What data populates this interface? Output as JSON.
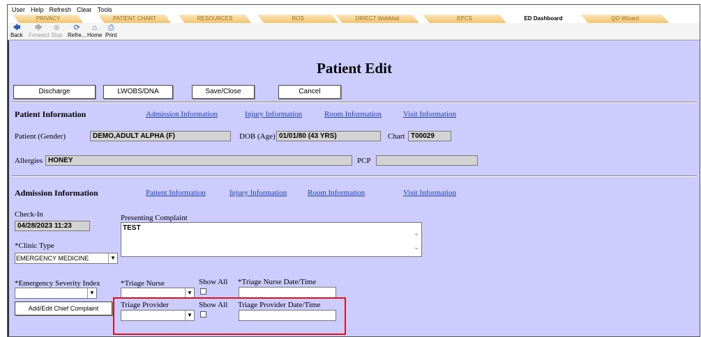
{
  "menu": [
    "User",
    "Help",
    "Refresh",
    "Clear",
    "Tools"
  ],
  "tabs": [
    {
      "label": "PRIVACY",
      "active": false
    },
    {
      "label": "PATIENT CHART",
      "active": false
    },
    {
      "label": "RESOURCES",
      "active": false
    },
    {
      "label": "ROS",
      "active": false
    },
    {
      "label": "DIRECT WebMail",
      "active": false
    },
    {
      "label": "EPCS",
      "active": false
    },
    {
      "label": "ED Dashboard",
      "active": true
    },
    {
      "label": "QO Wizard",
      "active": false
    }
  ],
  "toolbar": {
    "back": {
      "label": "Back",
      "icon": "back-arrow-icon"
    },
    "forward": {
      "label": "Forward",
      "icon": "forward-arrow-icon"
    },
    "stop": {
      "label": "Stop",
      "icon": "stop-icon"
    },
    "refresh": {
      "label": "Refre...",
      "icon": "refresh-icon"
    },
    "home": {
      "label": "Home",
      "icon": "home-icon"
    },
    "print": {
      "label": "Print",
      "icon": "print-icon"
    }
  },
  "page": {
    "title": "Patient Edit",
    "buttons": {
      "discharge": "Discharge",
      "lwobs": "LWOBS/DNA",
      "save_close": "Save/Close",
      "cancel": "Cancel"
    }
  },
  "patient_info": {
    "heading": "Patient Information",
    "links": [
      "Admission Information",
      "Injury Information",
      "Room Information",
      "Visit Information"
    ],
    "patient_label": "Patient (Gender)",
    "patient_value": "DEMO,ADULT ALPHA (F)",
    "dob_label": "DOB (Age)",
    "dob_value": "01/01/80 (43 YRS)",
    "chart_label": "Chart",
    "chart_value": "T00029",
    "allergies_label": "Allergies",
    "allergies_value": "HONEY",
    "pcp_label": "PCP",
    "pcp_value": ""
  },
  "admission_info": {
    "heading": "Admission Information",
    "links": [
      "Patient Information",
      "Injury Information",
      "Room Information",
      "Visit Information"
    ],
    "checkin_label": "Check-In",
    "checkin_value": "04/28/2023 11:23",
    "presenting_label": "Presenting Complaint",
    "presenting_value": "TEST",
    "clinic_type_label": "*Clinic Type",
    "clinic_type_value": "EMERGENCY MEDICINE",
    "esi_label": "*Emergency Severity Index",
    "esi_value": "",
    "triage_nurse_label": "*Triage Nurse",
    "triage_nurse_value": "",
    "show_all_label": "Show All",
    "triage_nurse_dt_label": "*Triage Nurse Date/Time",
    "add_edit_cc": "Add/Edit Chief Complaint",
    "triage_provider_label": "Triage Provider",
    "triage_provider_value": "",
    "triage_provider_dt_label": "Triage Provider Date/Time"
  },
  "colors": {
    "content_bg": "#ccccff",
    "link": "#1f3fc8",
    "highlight": "#e0101a",
    "tab": "#f2c46e"
  }
}
